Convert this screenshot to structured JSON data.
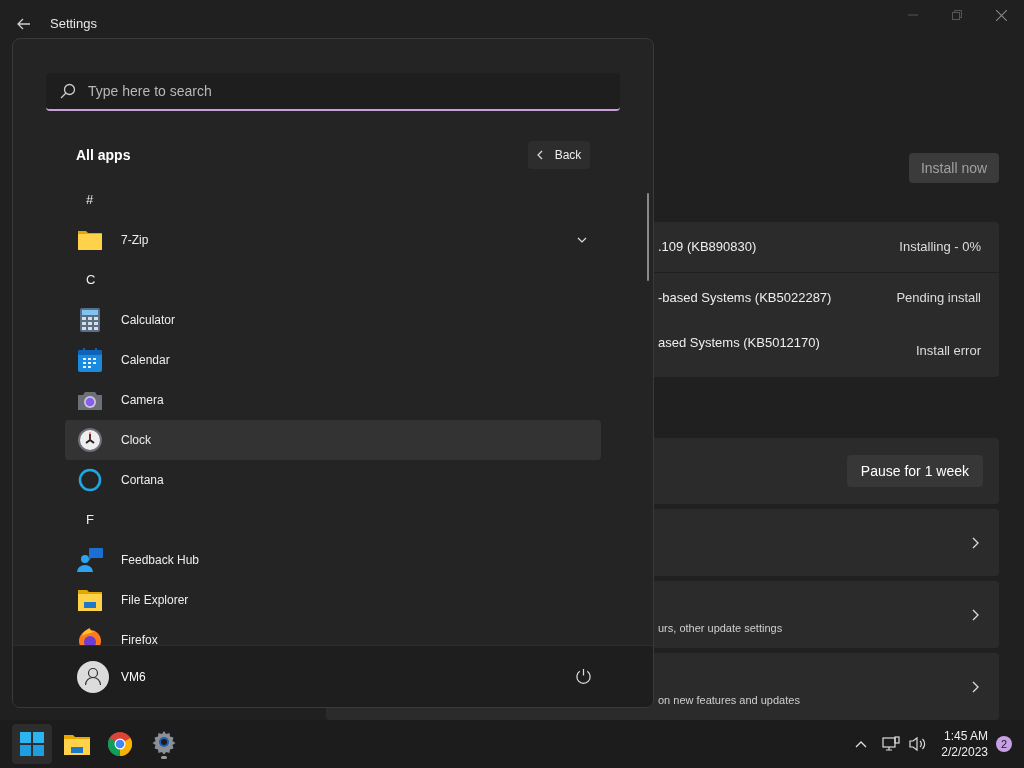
{
  "window": {
    "title": "Settings"
  },
  "install_button": "Install now",
  "updates": [
    {
      "name": ".109 (KB890830)",
      "status": "Installing - 0%"
    },
    {
      "name": "-based Systems (KB5022287)",
      "status": "Pending install"
    },
    {
      "name": "ased Systems (KB5012170)",
      "status": "Install error"
    }
  ],
  "pause_button": "Pause for 1 week",
  "setting_cards": [
    {
      "kind": "link"
    },
    {
      "kind": "described",
      "subtitle": "urs, other update settings"
    },
    {
      "kind": "described",
      "subtitle": "on new features and updates"
    }
  ],
  "start_menu": {
    "search": {
      "placeholder": "Type here to search"
    },
    "heading": "All apps",
    "back_button": "Back",
    "items": [
      {
        "kind": "header",
        "label": "#"
      },
      {
        "kind": "folder",
        "label": "7-Zip",
        "expanded": false
      },
      {
        "kind": "header",
        "label": "C"
      },
      {
        "kind": "app",
        "label": "Calculator",
        "highlighted": false
      },
      {
        "kind": "app",
        "label": "Calendar",
        "highlighted": false
      },
      {
        "kind": "app",
        "label": "Camera",
        "highlighted": false
      },
      {
        "kind": "app",
        "label": "Clock",
        "highlighted": true
      },
      {
        "kind": "app",
        "label": "Cortana",
        "highlighted": false
      },
      {
        "kind": "header",
        "label": "F"
      },
      {
        "kind": "app",
        "label": "Feedback Hub",
        "highlighted": false
      },
      {
        "kind": "app",
        "label": "File Explorer",
        "highlighted": false
      },
      {
        "kind": "app",
        "label": "Firefox",
        "highlighted": false
      }
    ],
    "user": "VM6"
  },
  "taskbar": {
    "time": "1:45 AM",
    "date": "2/2/2023",
    "notifications": "2"
  }
}
